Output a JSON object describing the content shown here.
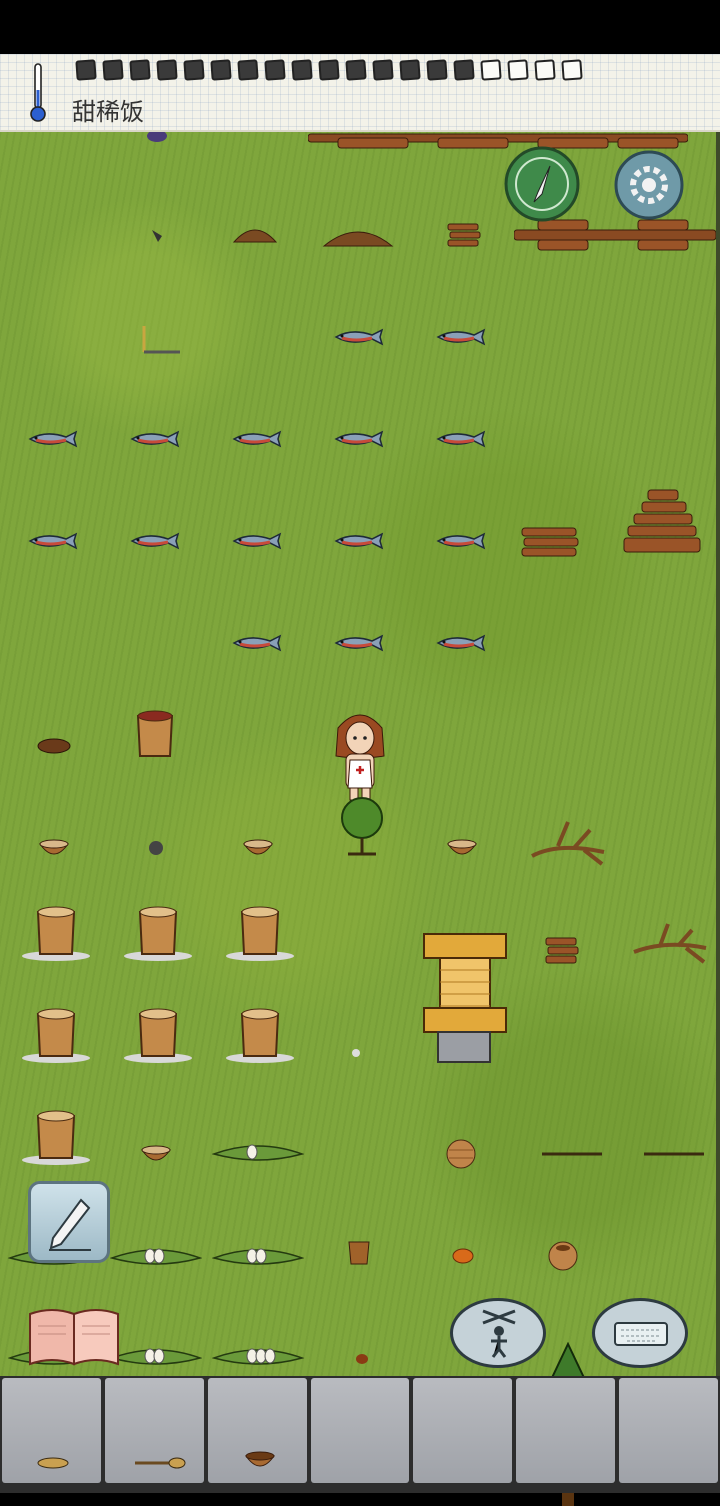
{
  "hud": {
    "food_label": "甜稀饭",
    "food_pips_total": 19,
    "food_pips_filled": 15,
    "thermometer_icon": "thermometer-icon"
  },
  "buttons": {
    "compass": "compass-icon",
    "settings": "gear-icon",
    "write": "pencil-icon",
    "book": "recipe-book-icon",
    "puppet": "puppet-icon",
    "keyboard": "keyboard-icon"
  },
  "colors": {
    "grass": "#7fa63c",
    "hud_paper": "#f3f2e9",
    "stone": "#aeb1b6"
  }
}
